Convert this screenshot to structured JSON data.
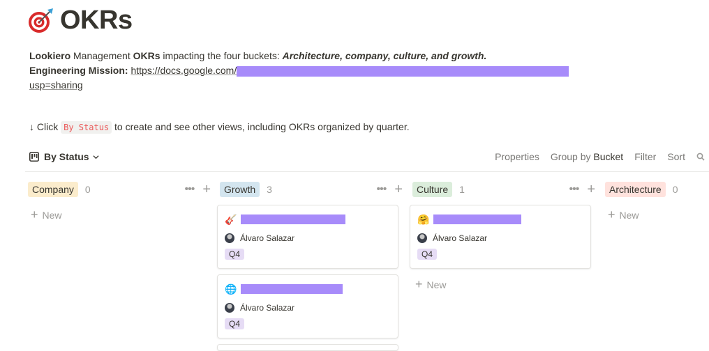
{
  "page": {
    "title": "OKRs",
    "description": {
      "brand": "Lookiero",
      "text1": " Management ",
      "okrs": "OKRs",
      "text2": " impacting the four buckets: ",
      "buckets": "Architecture, company, culture, and growth.",
      "mission_label": "Engineering Mission:",
      "mission_link": "https://docs.google.com/",
      "mission_link_tail": "usp=sharing"
    },
    "hint": {
      "arrow": "↓",
      "before": " Click ",
      "code": "By Status",
      "after": " to create and see other views, including OKRs organized by quarter."
    }
  },
  "toolbar": {
    "view_label": "By Status",
    "properties": "Properties",
    "group_by_prefix": "Group by ",
    "group_by_value": "Bucket",
    "filter": "Filter",
    "sort": "Sort"
  },
  "columns": [
    {
      "label": "Company",
      "count": "0",
      "tag_color": "#fbeccc",
      "new_label": "New"
    },
    {
      "label": "Growth",
      "count": "3",
      "tag_color": "#d3e5ef",
      "cards": [
        {
          "icon": "🎸",
          "person": "Álvaro Salazar",
          "tag": "Q4"
        },
        {
          "icon": "🌐",
          "person": "Álvaro Salazar",
          "tag": "Q4"
        }
      ]
    },
    {
      "label": "Culture",
      "count": "1",
      "tag_color": "#dbeddb",
      "new_label": "New",
      "cards": [
        {
          "icon": "🤗",
          "person": "Álvaro Salazar",
          "tag": "Q4"
        }
      ]
    },
    {
      "label": "Architecture",
      "count": "0",
      "tag_color": "#ffe2dd",
      "new_label": "New"
    }
  ],
  "colors": {
    "redaction": "#a78bfa",
    "code_text": "#eb5757"
  }
}
